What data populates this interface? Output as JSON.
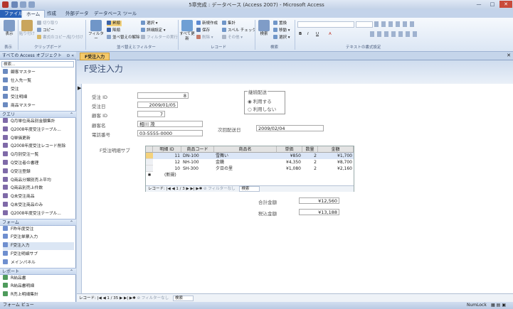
{
  "window": {
    "title": "5章完成 : データベース (Access 2007) - Microsoft Access",
    "controls": [
      "—",
      "□",
      "✕"
    ]
  },
  "ribbon": {
    "tabs": [
      "ファイル",
      "ホーム",
      "作成",
      "外部データ",
      "データベース ツール"
    ],
    "groups": {
      "view": {
        "label": "表示",
        "group": "表示"
      },
      "clipboard": {
        "paste": "貼り付け",
        "cut": "切り取り",
        "copy": "コピー",
        "format_painter": "書式のコピー/貼り付け",
        "group": "クリップボード"
      },
      "sort_filter": {
        "filter": "フィルター",
        "ascending": "昇順",
        "descending": "降順",
        "clear_sort": "並べ替えの解除",
        "selection": "選択",
        "advanced": "詳細設定",
        "toggle_filter": "フィルターの実行",
        "group": "並べ替えとフィルター"
      },
      "records": {
        "new": "新規作成",
        "save": "保存",
        "delete": "削除",
        "totals": "集計",
        "spelling": "スペル チェック",
        "more": "その他",
        "refresh": "すべて更新",
        "group": "レコード"
      },
      "find": {
        "find": "検索",
        "replace": "置換",
        "goto": "移動",
        "select": "選択",
        "group": "検索"
      },
      "text_format": {
        "group": "テキストの書式設定",
        "bold": "B",
        "italic": "I",
        "underline": "U",
        "font_color": "A"
      }
    }
  },
  "nav_pane": {
    "header": "すべての Access オブジェクト",
    "search_placeholder": "検索...",
    "sections": [
      {
        "name": "",
        "items": [
          "顧客マスター",
          "仕入先一覧",
          "受注",
          "受注明細",
          "商品マスター"
        ]
      },
      {
        "name": "クエリ",
        "items": [
          "Q月単位商品別金額集計",
          "Q2008年度受注テーブル...",
          "Q単価更新",
          "Q2008年度受注レコード削除",
          "Q月別受注一覧",
          "Q受注者の書理",
          "Q受注登録",
          "Q商品分類別売上平均",
          "Q商品別売上件数",
          "Q未受注商品",
          "Q未受注商品のみ",
          "Q2008年度受注テーブル..."
        ]
      },
      {
        "name": "フォーム",
        "items": [
          "F昨年度受注",
          "F受注単票入力",
          "F受注入力",
          "F受注明細サブ",
          "メインパネル"
        ]
      },
      {
        "name": "レポート",
        "items": [
          "R納品書",
          "R納品書明細",
          "R売上明細集計"
        ]
      }
    ],
    "selected_form": "F受注入力"
  },
  "document": {
    "tab": "F受注入力",
    "form_title": "F受注入力",
    "fields": {
      "order_id": {
        "label": "受注 ID",
        "value": "8"
      },
      "order_date": {
        "label": "受注日",
        "value": "2009/01/05"
      },
      "customer_id": {
        "label": "顧客 ID",
        "value": "7"
      },
      "customer_name": {
        "label": "顧客名",
        "value": "相川 茂"
      },
      "phone": {
        "label": "電話番号",
        "value": "03-5555-0000"
      },
      "next_delivery": {
        "label": "次回配送日",
        "value": "2009/02/04"
      }
    },
    "delivery_option": {
      "title": "継続配送",
      "options": [
        "利用する",
        "利用しない"
      ]
    },
    "subform": {
      "label": "F受注明細サブ",
      "columns": [
        "明細 ID",
        "商品コード",
        "商品名",
        "単価",
        "数量",
        "金額"
      ],
      "rows": [
        [
          "11",
          "DN-100",
          "雪舞い",
          "¥850",
          "2",
          "¥1,700"
        ],
        [
          "12",
          "NH-100",
          "金鏡",
          "¥4,350",
          "2",
          "¥8,700"
        ],
        [
          "10",
          "SH-300",
          "夕日の里",
          "¥1,080",
          "2",
          "¥2,160"
        ]
      ],
      "new_row": "(新規)",
      "nav": {
        "label": "レコード:",
        "position": "1 / 3",
        "filter": "フィルターなし",
        "search": "検索"
      }
    },
    "totals": {
      "subtotal_label": "合計金額",
      "subtotal_value": "¥12,560",
      "tax_label": "税込金額",
      "tax_value": "¥13,188"
    },
    "main_nav": {
      "label": "レコード:",
      "position": "1 / 35",
      "filter": "フィルターなし",
      "search": "検索"
    }
  },
  "statusbar": {
    "left": "フォーム ビュー",
    "right": "NumLock"
  }
}
